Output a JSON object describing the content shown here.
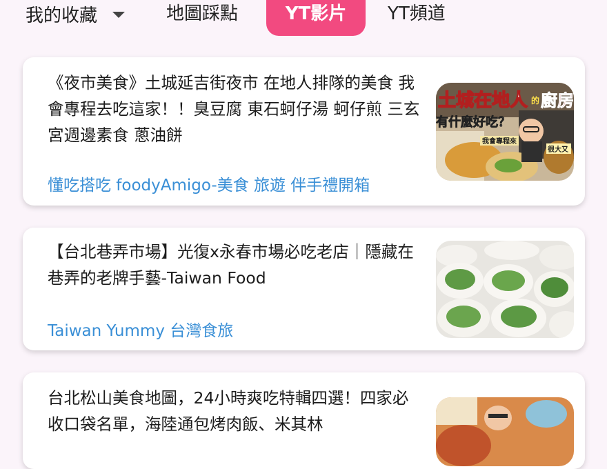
{
  "tabs": {
    "favorites": "我的收藏",
    "map": "地圖踩點",
    "yt_videos": "YT影片",
    "yt_channels": "YT頻道"
  },
  "videos": [
    {
      "title": "《夜市美食》土城延吉街夜市 在地人排隊的美食 我會專程去吃這家！！臭豆腐 東石蚵仔湯 蚵仔煎 三玄宮週邊素食 蔥油餅",
      "channel": "懂吃搭吃 foodyAmigo-美食 旅遊 伴手禮開箱",
      "thumb_text": {
        "line1": "土城在地人",
        "small": "的",
        "line1b": "廚房",
        "line2": "有什麼好吃？",
        "tag1": "我會專程來",
        "tag2": "很大又"
      }
    },
    {
      "title": "【台北巷弄市場】光復x永春市場必吃老店｜隱藏在巷弄的老牌手藝-Taiwan Food",
      "channel": "Taiwan Yummy 台灣食旅"
    },
    {
      "title": "台北松山美食地圖，24小時爽吃特輯四選！四家必收口袋名單，海陸通包烤肉飯、米其林",
      "channel": ""
    }
  ],
  "colors": {
    "background": "#fbf4fa",
    "accent": "#f24a80",
    "channel_link": "#3a8fd6"
  }
}
